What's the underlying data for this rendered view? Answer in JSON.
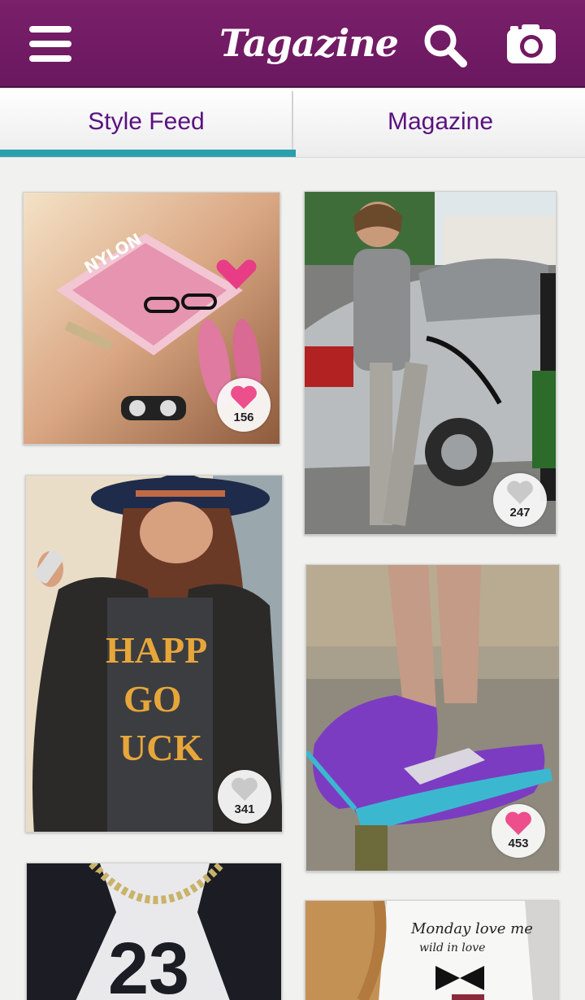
{
  "header": {
    "title": "Tagazine",
    "menu_icon": "hamburger-menu-icon",
    "search_icon": "search-icon",
    "camera_icon": "camera-icon",
    "bar_color": "#73195f"
  },
  "tabs": [
    {
      "label": "Style Feed",
      "active": true
    },
    {
      "label": "Magazine",
      "active": false
    }
  ],
  "accent_color": "#2a9fae",
  "feed": [
    {
      "description": "magazine flatlay",
      "likes": "156",
      "liked": true
    },
    {
      "description": "man at gas station",
      "likes": "247",
      "liked": false
    },
    {
      "description": "woman in hat",
      "likes": "341",
      "liked": false
    },
    {
      "description": "purple sneakers",
      "likes": "453",
      "liked": true
    },
    {
      "description": "jersey with necklace",
      "likes": "",
      "liked": false
    },
    {
      "description": "graphic tee",
      "likes": "",
      "liked": false
    }
  ]
}
